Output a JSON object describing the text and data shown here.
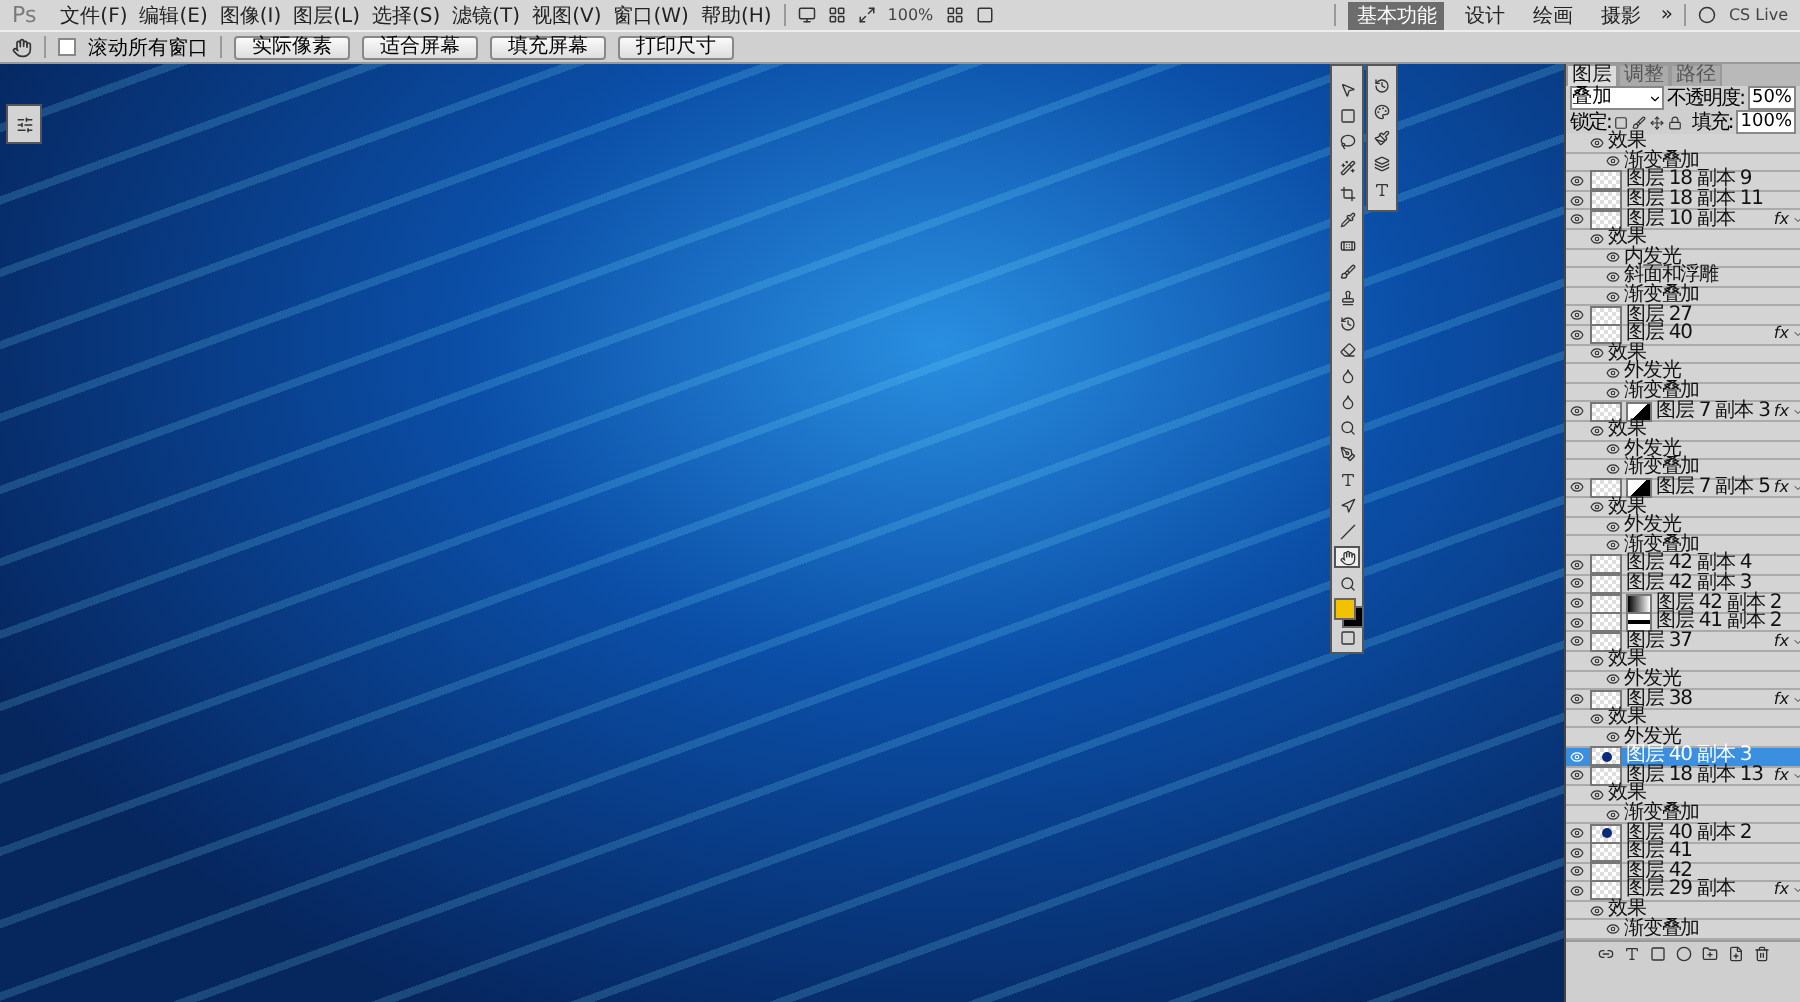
{
  "app_logo": "Ps",
  "menu": [
    "文件(F)",
    "编辑(E)",
    "图像(I)",
    "图层(L)",
    "选择(S)",
    "滤镜(T)",
    "视图(V)",
    "窗口(W)",
    "帮助(H)"
  ],
  "zoom_level": "100%",
  "workspaces": [
    {
      "label": "基本功能",
      "selected": true
    },
    {
      "label": "设计",
      "selected": false
    },
    {
      "label": "绘画",
      "selected": false
    },
    {
      "label": "摄影",
      "selected": false
    }
  ],
  "more_workspaces": "»",
  "cs_live": "CS Live",
  "options_bar": {
    "scroll_all": {
      "label": "滚动所有窗口",
      "checked": false
    },
    "buttons": [
      "实际像素",
      "适合屏幕",
      "填充屏幕",
      "打印尺寸"
    ]
  },
  "tools": [
    {
      "selected": false
    },
    {
      "selected": false
    },
    {
      "selected": false
    },
    {
      "selected": false
    },
    {
      "selected": false
    },
    {
      "selected": false
    },
    {
      "selected": false
    },
    {
      "selected": false
    },
    {
      "selected": false
    },
    {
      "selected": false
    },
    {
      "selected": false
    },
    {
      "selected": false
    },
    {
      "selected": false
    },
    {
      "selected": false
    },
    {
      "selected": false
    },
    {
      "selected": false
    },
    {
      "selected": false
    },
    {
      "selected": false
    },
    {
      "selected": true
    },
    {
      "selected": false
    }
  ],
  "swatches": [
    {
      "color": "#f2c200"
    },
    {
      "color": "#000000"
    }
  ],
  "layers_panel": {
    "tabs": [
      {
        "label": "图层",
        "selected": true
      },
      {
        "label": "调整",
        "selected": false
      },
      {
        "label": "路径",
        "selected": false
      }
    ],
    "blend_mode": "叠加",
    "opacity_label": "不透明度:",
    "opacity": "50%",
    "lock_label": "锁定:",
    "fill_label": "填充:",
    "fill": "100%",
    "orphan_effects": {
      "label": "效果",
      "effects": [
        "渐变叠加"
      ]
    },
    "layers": [
      {
        "name": "图层 18 副本 9",
        "visible": true,
        "selected": false,
        "kind": "pixel"
      },
      {
        "name": "图层 18 副本 11",
        "visible": true,
        "selected": false,
        "kind": "pixel"
      },
      {
        "name": "图层 10 副本",
        "visible": true,
        "selected": false,
        "kind": "pixel",
        "fx": "fx",
        "effects_label": "效果",
        "effects": [
          "内发光",
          "斜面和浮雕",
          "渐变叠加"
        ]
      },
      {
        "name": "图层 27",
        "visible": true,
        "selected": false,
        "kind": "pixel"
      },
      {
        "name": "图层 40",
        "visible": true,
        "selected": false,
        "kind": "pixel",
        "fx": "fx",
        "effects_label": "效果",
        "effects": [
          "外发光",
          "渐变叠加"
        ]
      },
      {
        "name": "图层 7 副本 3",
        "visible": true,
        "selected": false,
        "kind": "shapemask",
        "fx": "fx",
        "effects_label": "效果",
        "effects": [
          "外发光",
          "渐变叠加"
        ]
      },
      {
        "name": "图层 7 副本 5",
        "visible": true,
        "selected": false,
        "kind": "shapemask",
        "fx": "fx",
        "effects_label": "效果",
        "effects": [
          "外发光",
          "渐变叠加"
        ]
      },
      {
        "name": "图层 42 副本 4",
        "visible": true,
        "selected": false,
        "kind": "pixel"
      },
      {
        "name": "图层 42 副本 3",
        "visible": true,
        "selected": false,
        "kind": "pixel"
      },
      {
        "name": "图层 42 副本 2",
        "visible": true,
        "selected": false,
        "kind": "gradientmask"
      },
      {
        "name": "图层 41 副本 2",
        "visible": true,
        "selected": false,
        "kind": "barmask"
      },
      {
        "name": "图层 37",
        "visible": true,
        "selected": false,
        "kind": "pixel",
        "fx": "fx",
        "effects_label": "效果",
        "effects": [
          "外发光"
        ]
      },
      {
        "name": "图层 38",
        "visible": true,
        "selected": false,
        "kind": "pixel",
        "fx": "fx",
        "effects_label": "效果",
        "effects": [
          "外发光"
        ]
      },
      {
        "name": "图层 40 副本 3",
        "visible": true,
        "selected": true,
        "kind": "dot"
      },
      {
        "name": "图层 18 副本 13",
        "visible": true,
        "selected": false,
        "kind": "pixel",
        "fx": "fx",
        "effects_label": "效果",
        "effects": [
          "渐变叠加"
        ]
      },
      {
        "name": "图层 40 副本 2",
        "visible": true,
        "selected": false,
        "kind": "dot"
      },
      {
        "name": "图层 41",
        "visible": true,
        "selected": false,
        "kind": "pixel"
      },
      {
        "name": "图层 42",
        "visible": true,
        "selected": false,
        "kind": "pixel"
      },
      {
        "name": "图层 29 副本",
        "visible": true,
        "selected": false,
        "kind": "fill",
        "fx": "fx",
        "effects_label": "效果",
        "effects": [
          "渐变叠加"
        ]
      }
    ]
  }
}
